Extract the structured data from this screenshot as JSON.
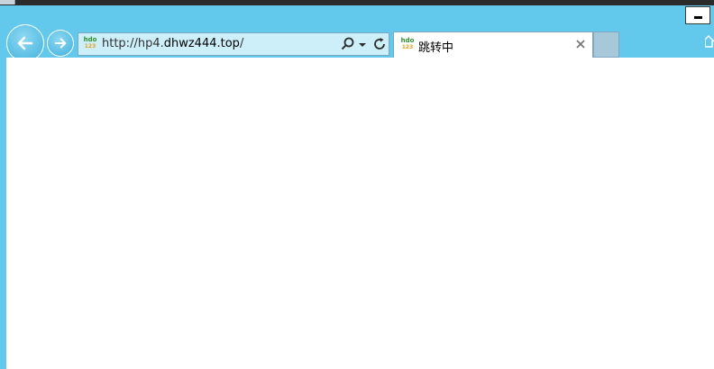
{
  "toolbar": {
    "url_prefix": "http://hp4.",
    "url_domain": "dhwz444.top",
    "url_suffix": "/",
    "icons": [
      "back-arrow-icon",
      "forward-arrow-icon",
      "search-icon",
      "dropdown-arrow-icon",
      "refresh-icon",
      "home-icon"
    ]
  },
  "favicon": {
    "top": "hdo",
    "bottom": "123"
  },
  "tab": {
    "title": "跳转中",
    "close_icon": "close-icon"
  },
  "colors": {
    "frame": "#62c8ec",
    "address_bar": "#cdeffa",
    "tab_background": "#ffffff",
    "content": "#ffffff"
  }
}
